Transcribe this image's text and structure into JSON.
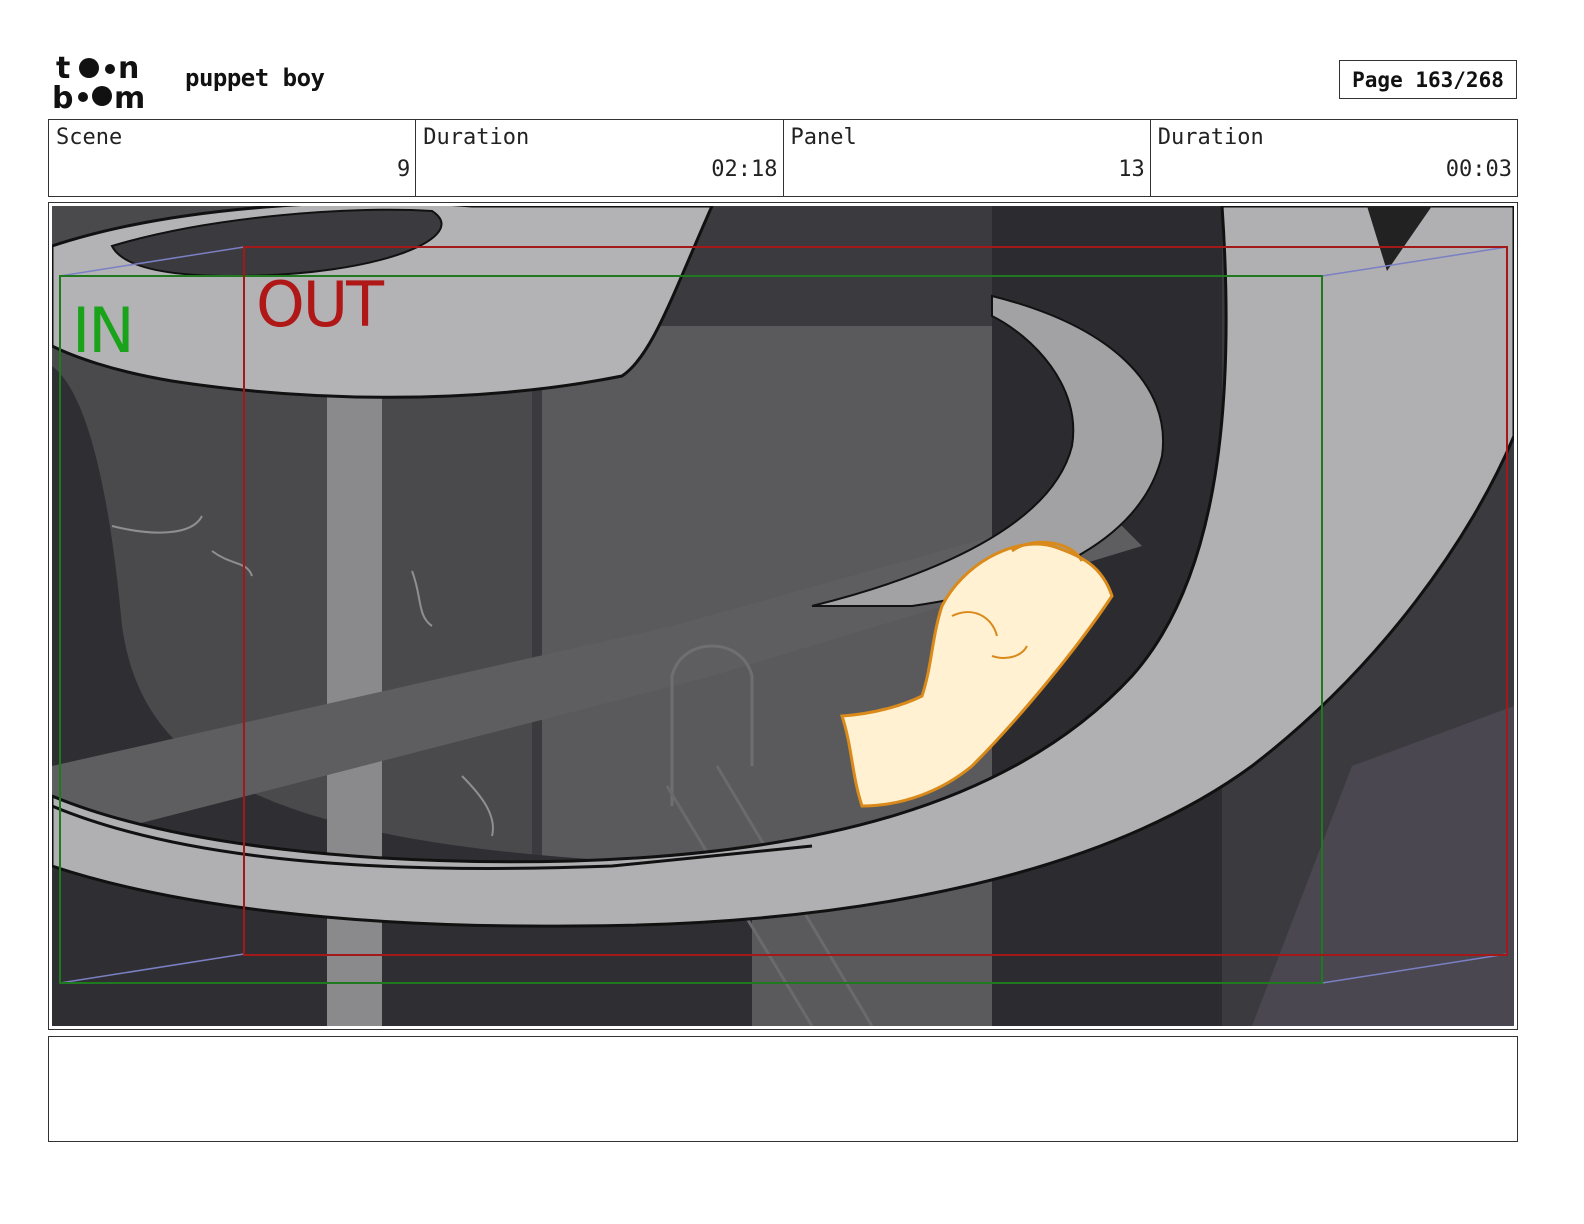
{
  "header": {
    "logo_text": "toon boom",
    "project_title": "puppet boy",
    "page_label": "Page 163/268"
  },
  "info": [
    {
      "label": "Scene",
      "value": "9"
    },
    {
      "label": "Duration",
      "value": "02:18"
    },
    {
      "label": "Panel",
      "value": "13"
    },
    {
      "label": "Duration",
      "value": "00:03"
    }
  ],
  "panel": {
    "in_label": "IN",
    "out_label": "OUT",
    "colors": {
      "in_frame": "#1aa31a",
      "out_frame": "#b01818",
      "move_path": "#7b7fc4",
      "character": "#fff1d2",
      "character_line": "#d98a1a"
    }
  },
  "notes": {
    "text": ""
  }
}
